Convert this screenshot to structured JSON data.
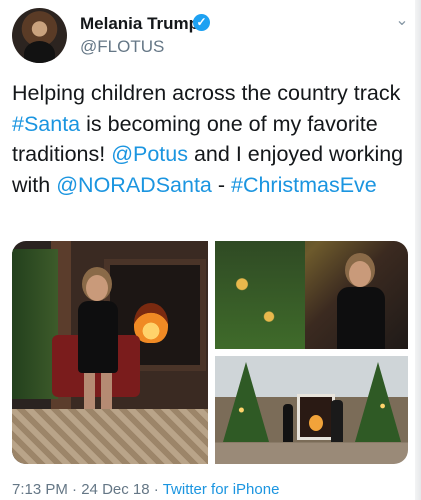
{
  "author": {
    "display_name": "Melania Trump",
    "handle": "@FLOTUS",
    "verified_icon": "verified-badge-icon",
    "avatar_icon": "avatar-photo"
  },
  "tweet": {
    "segments": [
      {
        "text": "Helping children across the country track ",
        "type": "text"
      },
      {
        "text": "#Santa",
        "type": "hashtag"
      },
      {
        "text": " is becoming one of my favorite traditions! ",
        "type": "text"
      },
      {
        "text": "@Potus",
        "type": "mention"
      },
      {
        "text": " and I enjoyed working with ",
        "type": "text"
      },
      {
        "text": "@NORADSanta",
        "type": "mention"
      },
      {
        "text": " - ",
        "type": "text"
      },
      {
        "text": "#ChristmasEve",
        "type": "hashtag"
      }
    ]
  },
  "media": {
    "photos": [
      {
        "id": "left",
        "subject": "seated woman on phone by fireplace"
      },
      {
        "id": "top-right",
        "subject": "woman on phone by christmas tree"
      },
      {
        "id": "bottom-right",
        "subject": "room with two christmas trees and fireplace"
      }
    ]
  },
  "meta": {
    "time": "7:13 PM",
    "separator": "·",
    "date": "24 Dec 18",
    "source": "Twitter for iPhone"
  },
  "colors": {
    "link": "#1b95e0",
    "verified": "#1da1f2",
    "secondary_text": "#657786"
  }
}
